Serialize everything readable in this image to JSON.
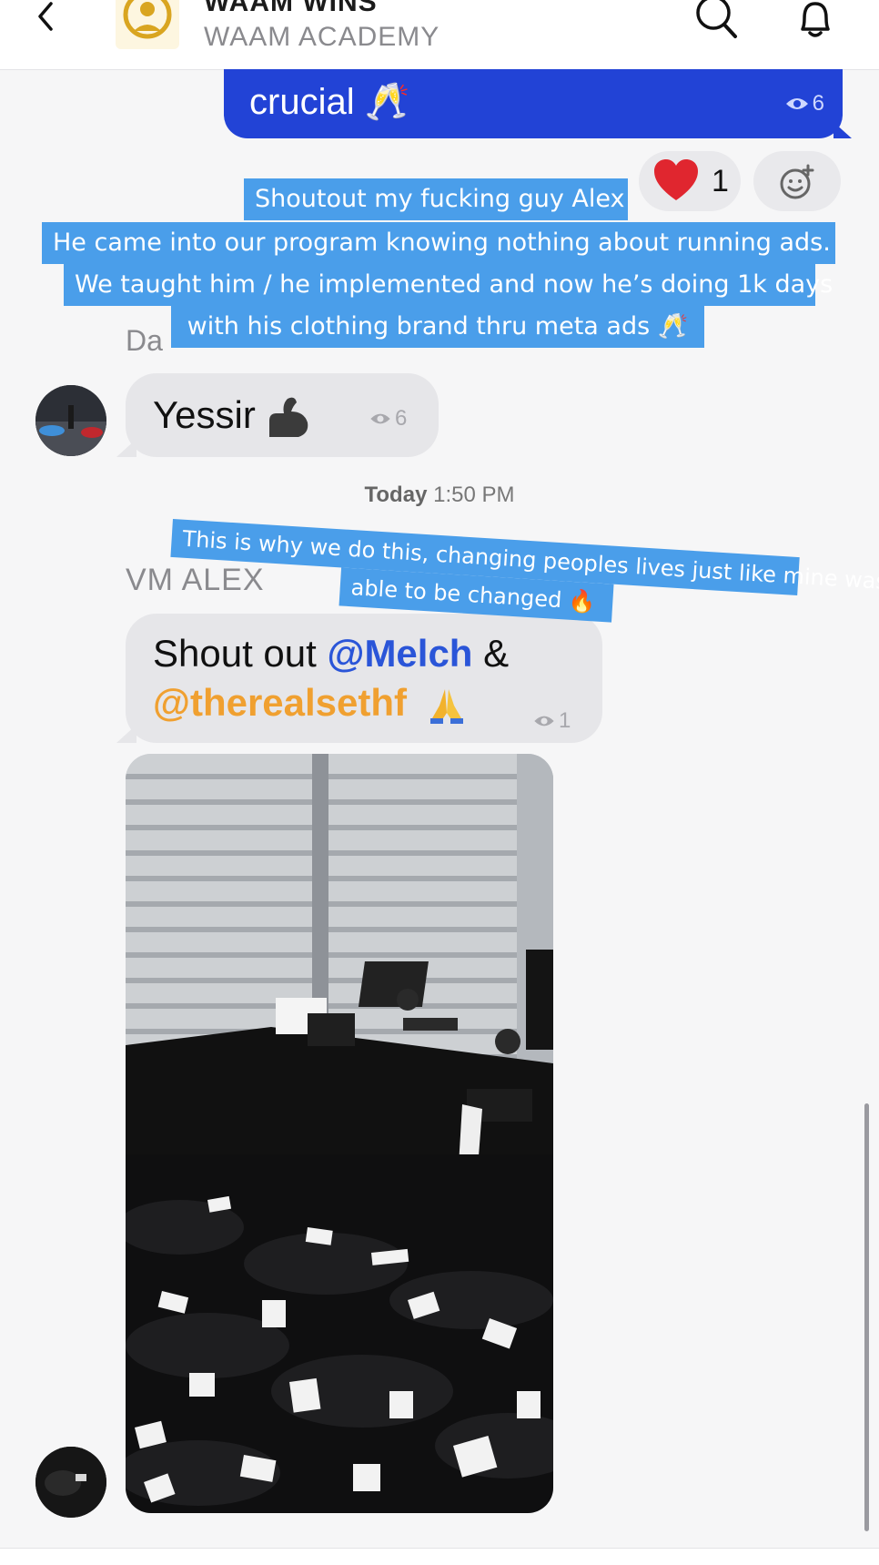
{
  "header": {
    "title": "WAAM WINS",
    "subtitle": "WAAM ACADEMY",
    "icons": [
      "back-icon",
      "search-icon",
      "bell-icon"
    ]
  },
  "messages": {
    "outgoing_partial": {
      "text": "crucial 🥂",
      "views": "6"
    },
    "reaction": {
      "emoji": "heart-icon",
      "count": "1"
    },
    "sender_partial": "Da",
    "yessir": {
      "text": "Yessir",
      "views": "6"
    },
    "date_separator": {
      "day": "Today",
      "time": "1:50 PM"
    },
    "vm_alex": {
      "sender": "VM ALEX",
      "line1_prefix": "Shout out ",
      "mention1": "@Melch",
      "line1_suffix": " &",
      "mention2": "@therealsethf",
      "views": "1"
    }
  },
  "captions": {
    "caption1": [
      "Shoutout my fucking guy Alex",
      "He came into our program knowing nothing about running ads.",
      "We taught him / he implemented and now he’s doing 1k days",
      "with his clothing brand thru meta ads 🥂"
    ],
    "caption2": [
      "This is why we do this, changing peoples lives just like mine was",
      "able to be changed 🔥"
    ]
  },
  "colors": {
    "outgoing_bubble": "#2243d6",
    "incoming_bubble": "#e6e6e9",
    "caption_bg": "#4a9eea",
    "mention_blue": "#2a55d8",
    "mention_orange": "#f0a030"
  }
}
